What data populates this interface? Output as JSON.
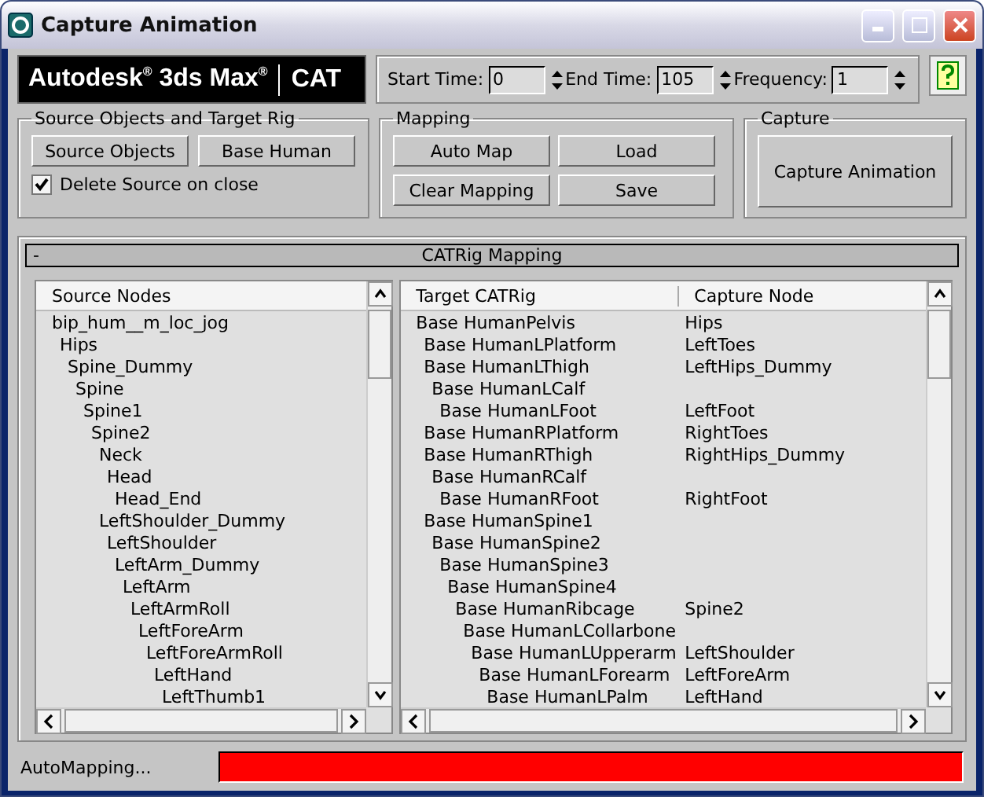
{
  "window": {
    "title": "Capture Animation"
  },
  "logo": {
    "brand": "Autodesk$^{®}$ 3ds Max$^{®}$",
    "module": "CAT"
  },
  "time": [
    {
      "label": "Start Time:",
      "value": "0"
    },
    {
      "label": "End Time:",
      "value": "105"
    },
    {
      "label": "Frequency:",
      "value": "1"
    }
  ],
  "source_group": {
    "title": "Source Objects and Target Rig",
    "buttons": [
      "Source Objects",
      "Base Human"
    ],
    "checkbox": {
      "label": "Delete Source on close",
      "checked": true
    }
  },
  "mapping_group": {
    "title": "Mapping",
    "buttons": [
      "Auto Map",
      "Load",
      "Clear Mapping",
      "Save"
    ]
  },
  "capture_group": {
    "title": "Capture",
    "button": "Capture Animation"
  },
  "rollout": {
    "title": "CATRig Mapping",
    "toggle": "-",
    "expanded": true
  },
  "source_list": {
    "header": "Source Nodes",
    "nodes": [
      {
        "name": "bip_hum__m_loc_jog",
        "children": [
          {
            "name": "Hips",
            "children": [
              {
                "name": "Spine_Dummy",
                "children": [
                  {
                    "name": "Spine",
                    "children": [
                      {
                        "name": "Spine1",
                        "children": [
                          {
                            "name": "Spine2",
                            "children": [
                              {
                                "name": "Neck",
                                "children": [
                                  {
                                    "name": "Head",
                                    "children": [
                                      {
                                        "name": "Head_End"
                                      }
                                    ]
                                  }
                                ]
                              },
                              {
                                "name": "LeftShoulder_Dummy",
                                "children": [
                                  {
                                    "name": "LeftShoulder",
                                    "children": [
                                      {
                                        "name": "LeftArm_Dummy",
                                        "children": [
                                          {
                                            "name": "LeftArm",
                                            "children": [
                                              {
                                                "name": "LeftArmRoll",
                                                "children": [
                                                  {
                                                    "name": "LeftForeArm",
                                                    "children": [
                                                      {
                                                        "name": "LeftForeArmRoll",
                                                        "children": [
                                                          {
                                                            "name": "LeftHand",
                                                            "children": [
                                                              {
                                                                "name": "LeftThumb1"
                                                              }
                                                            ]
                                                          }
                                                        ]
                                                      }
                                                    ]
                                                  }
                                                ]
                                              }
                                            ]
                                          }
                                        ]
                                      }
                                    ]
                                  }
                                ]
                              }
                            ]
                          }
                        ]
                      }
                    ]
                  }
                ]
              }
            ]
          }
        ]
      }
    ]
  },
  "target_list": {
    "columns": [
      "Target CATRig",
      "Capture Node"
    ],
    "nodes": [
      {
        "name": "Base HumanPelvis",
        "capture": "Hips",
        "children": [
          {
            "name": "Base HumanLPlatform",
            "capture": "LeftToes"
          },
          {
            "name": "Base HumanLThigh",
            "capture": "LeftHips_Dummy",
            "children": [
              {
                "name": "Base HumanLCalf",
                "children": [
                  {
                    "name": "Base HumanLFoot",
                    "capture": "LeftFoot"
                  }
                ]
              }
            ]
          },
          {
            "name": "Base HumanRPlatform",
            "capture": "RightToes"
          },
          {
            "name": "Base HumanRThigh",
            "capture": "RightHips_Dummy",
            "children": [
              {
                "name": "Base HumanRCalf",
                "children": [
                  {
                    "name": "Base HumanRFoot",
                    "capture": "RightFoot"
                  }
                ]
              }
            ]
          },
          {
            "name": "Base HumanSpine1",
            "children": [
              {
                "name": "Base HumanSpine2",
                "children": [
                  {
                    "name": "Base HumanSpine3",
                    "children": [
                      {
                        "name": "Base HumanSpine4",
                        "children": [
                          {
                            "name": "Base HumanRibcage",
                            "capture": "Spine2",
                            "children": [
                              {
                                "name": "Base HumanLCollarbone",
                                "children": [
                                  {
                                    "name": "Base HumanLUpperarm",
                                    "capture": "LeftShoulder",
                                    "children": [
                                      {
                                        "name": "Base HumanLForearm",
                                        "capture": "LeftForeArm",
                                        "children": [
                                          {
                                            "name": "Base HumanLPalm",
                                            "capture": "LeftHand"
                                          }
                                        ]
                                      }
                                    ]
                                  }
                                ]
                              }
                            ]
                          }
                        ]
                      }
                    ]
                  }
                ]
              }
            ]
          }
        ]
      }
    ]
  },
  "status": {
    "text": "AutoMapping...",
    "level": 1
  }
}
